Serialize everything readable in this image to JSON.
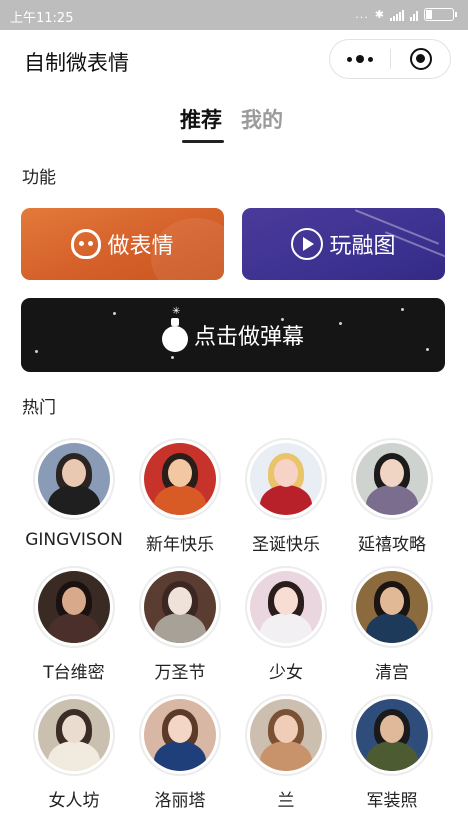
{
  "status_bar": {
    "time": "上午11:25",
    "dots": "...",
    "icons": [
      "bluetooth-icon",
      "signal-icon",
      "wifi-icon",
      "battery-icon"
    ]
  },
  "header": {
    "title": "自制微表情",
    "capsule": {
      "menu_icon": "more-dots-icon",
      "close_icon": "target-close-icon"
    }
  },
  "tabs": [
    {
      "label": "推荐",
      "active": true
    },
    {
      "label": "我的",
      "active": false
    }
  ],
  "functions": {
    "section_title": "功能",
    "make_expression": {
      "label": "做表情",
      "icon": "ghost-face-icon",
      "color": "#d5602a"
    },
    "fuse_image": {
      "label": "玩融图",
      "icon": "play-circle-icon",
      "color": "#3d3291"
    },
    "danmu": {
      "label": "点击做弹幕",
      "icon": "bomb-icon",
      "color": "#151515"
    }
  },
  "hot": {
    "section_title": "热门",
    "items": [
      {
        "label": "GINGVISON",
        "palette": [
          "#8a9bb8",
          "#e9c9b2",
          "#1f1f1f",
          "#2b2420"
        ]
      },
      {
        "label": "新年快乐",
        "palette": [
          "#c7322b",
          "#f2c7a1",
          "#d85b26",
          "#2a1e1a"
        ]
      },
      {
        "label": "圣诞快乐",
        "palette": [
          "#e8eef4",
          "#f6d3c6",
          "#b9212a",
          "#e9c46a"
        ]
      },
      {
        "label": "延禧攻略",
        "palette": [
          "#cfd3d0",
          "#f0d4c4",
          "#7a6d8e",
          "#1d1a1a"
        ]
      },
      {
        "label": "T台维密",
        "palette": [
          "#3a2a24",
          "#d9a98c",
          "#4b2f2a",
          "#1a1210"
        ]
      },
      {
        "label": "万圣节",
        "palette": [
          "#5a3c30",
          "#efe3d9",
          "#a8a197",
          "#3a2622"
        ]
      },
      {
        "label": "少女",
        "palette": [
          "#ead6df",
          "#f7ddd3",
          "#f3f0f3",
          "#2a1d1c"
        ]
      },
      {
        "label": "清宫",
        "palette": [
          "#8b6a3d",
          "#e2b996",
          "#1d3a5a",
          "#1a1412"
        ]
      },
      {
        "label": "女人坊",
        "palette": [
          "#c9c0b0",
          "#eadccf",
          "#f1eadf",
          "#3b2d25"
        ]
      },
      {
        "label": "洛丽塔",
        "palette": [
          "#d8b8a4",
          "#f4d6c6",
          "#1f3f7a",
          "#5b3a2a"
        ]
      },
      {
        "label": "兰",
        "palette": [
          "#cdbfb0",
          "#efcdb6",
          "#c8936b",
          "#7a5135"
        ]
      },
      {
        "label": "军装照",
        "palette": [
          "#2f4d7a",
          "#e0b99a",
          "#4d5b33",
          "#1a1a1a"
        ]
      }
    ]
  }
}
